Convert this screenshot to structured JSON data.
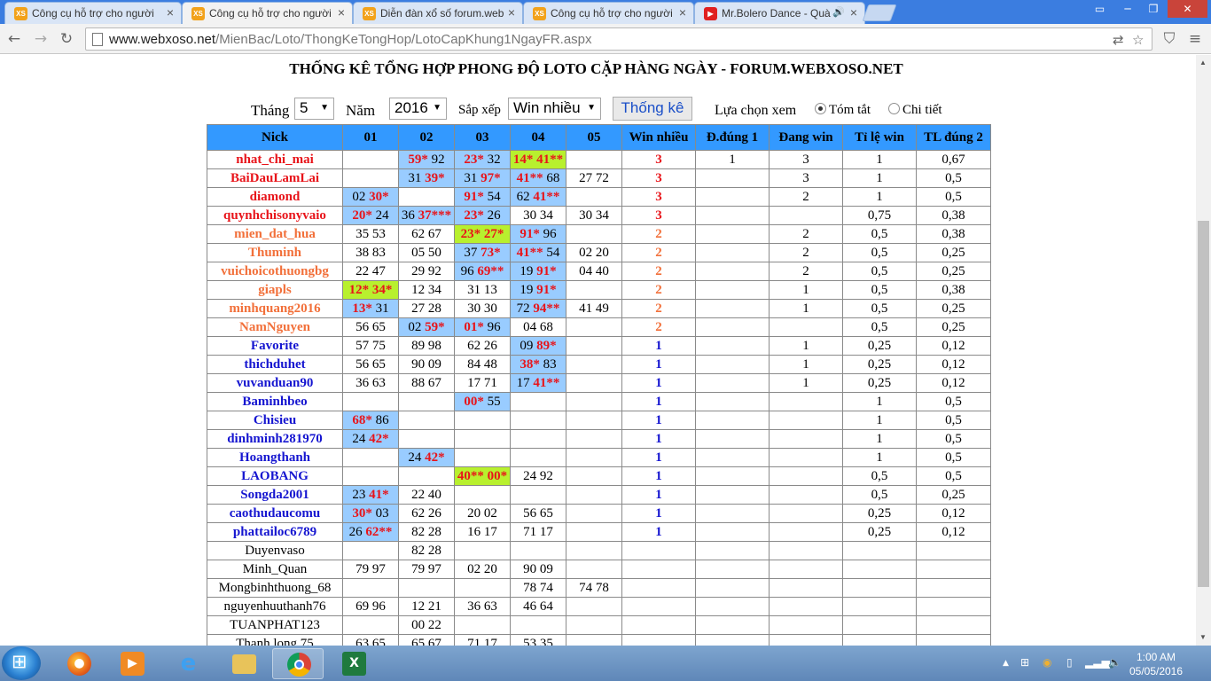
{
  "browser": {
    "tabs": [
      {
        "label": "Công cụ hỗ trợ cho người",
        "favicon": "XS",
        "active": false
      },
      {
        "label": "Công cụ hỗ trợ cho người",
        "favicon": "XS",
        "active": true
      },
      {
        "label": "Diễn đàn xổ số forum.web",
        "favicon": "XS",
        "active": false
      },
      {
        "label": "Công cụ hỗ trợ cho người",
        "favicon": "XS",
        "active": false
      },
      {
        "label": "Mr.Bolero Dance - Quà",
        "favicon": "youtube",
        "active": false,
        "audio": true
      }
    ],
    "url_host": "www.webxoso.net",
    "url_path": "/MienBac/Loto/ThongKeTongHop/LotoCapKhung1NgayFR.aspx"
  },
  "page": {
    "title": "THỐNG KÊ TỔNG HỢP PHONG ĐỘ LOTO CẶP HÀNG NGÀY - FORUM.WEBXOSO.NET",
    "controls": {
      "month_label": "Tháng",
      "month_value": "5",
      "year_label": "Năm",
      "year_value": "2016",
      "sort_label": "Sắp xếp",
      "sort_value": "Win nhiều",
      "submit_label": "Thống kê",
      "view_label": "Lựa chọn xem",
      "view_summary": "Tóm tắt",
      "view_detail": "Chi tiết",
      "selected_view": "summary"
    }
  },
  "table": {
    "headers": [
      "Nick",
      "01",
      "02",
      "03",
      "04",
      "05",
      "Win nhiều",
      "Đ.đúng 1",
      "Đang win",
      "Tỉ lệ win",
      "TL đúng 2"
    ],
    "colors": {
      "red": "#e8141a",
      "orange": "#f2703a",
      "blue": "#1515d0",
      "header_bg": "#3399ff",
      "hit_bg": "#99ccff",
      "double_hit_bg": "#b8f02e"
    },
    "rows": [
      {
        "nick": "nhat_chi_mai",
        "color": "red",
        "days": [
          {
            "t": "",
            "bg": ""
          },
          {
            "t": "59* 92",
            "bg": "blue"
          },
          {
            "t": "23* 32",
            "bg": "blue"
          },
          {
            "t": "14* 41**",
            "bg": "green"
          },
          {
            "t": "",
            "bg": ""
          }
        ],
        "win": "3",
        "dd1": "1",
        "dangwin": "3",
        "tlwin": "1",
        "tl2": "0,67"
      },
      {
        "nick": "BaiDauLamLai",
        "color": "red",
        "days": [
          {
            "t": "",
            "bg": ""
          },
          {
            "t": "31 39*",
            "bg": "blue"
          },
          {
            "t": "31 97*",
            "bg": "blue"
          },
          {
            "t": "41** 68",
            "bg": "blue"
          },
          {
            "t": "27 72",
            "bg": ""
          }
        ],
        "win": "3",
        "dd1": "",
        "dangwin": "3",
        "tlwin": "1",
        "tl2": "0,5"
      },
      {
        "nick": "diamond",
        "color": "red",
        "days": [
          {
            "t": "02 30*",
            "bg": "blue"
          },
          {
            "t": "",
            "bg": ""
          },
          {
            "t": "91* 54",
            "bg": "blue"
          },
          {
            "t": "62 41**",
            "bg": "blue"
          },
          {
            "t": "",
            "bg": ""
          }
        ],
        "win": "3",
        "dd1": "",
        "dangwin": "2",
        "tlwin": "1",
        "tl2": "0,5"
      },
      {
        "nick": "quynhchisonyvaio",
        "color": "red",
        "days": [
          {
            "t": "20* 24",
            "bg": "blue"
          },
          {
            "t": "36 37***",
            "bg": "blue"
          },
          {
            "t": "23* 26",
            "bg": "blue"
          },
          {
            "t": "30 34",
            "bg": ""
          },
          {
            "t": "30 34",
            "bg": ""
          }
        ],
        "win": "3",
        "dd1": "",
        "dangwin": "",
        "tlwin": "0,75",
        "tl2": "0,38"
      },
      {
        "nick": "mien_dat_hua",
        "color": "orange",
        "days": [
          {
            "t": "35 53",
            "bg": ""
          },
          {
            "t": "62 67",
            "bg": ""
          },
          {
            "t": "23* 27*",
            "bg": "green"
          },
          {
            "t": "91* 96",
            "bg": "blue"
          },
          {
            "t": "",
            "bg": ""
          }
        ],
        "win": "2",
        "dd1": "",
        "dangwin": "2",
        "tlwin": "0,5",
        "tl2": "0,38"
      },
      {
        "nick": "Thuminh",
        "color": "orange",
        "days": [
          {
            "t": "38 83",
            "bg": ""
          },
          {
            "t": "05 50",
            "bg": ""
          },
          {
            "t": "37 73*",
            "bg": "blue"
          },
          {
            "t": "41** 54",
            "bg": "blue"
          },
          {
            "t": "02 20",
            "bg": ""
          }
        ],
        "win": "2",
        "dd1": "",
        "dangwin": "2",
        "tlwin": "0,5",
        "tl2": "0,25"
      },
      {
        "nick": "vuichoicothuongbg",
        "color": "orange",
        "days": [
          {
            "t": "22 47",
            "bg": ""
          },
          {
            "t": "29 92",
            "bg": ""
          },
          {
            "t": "96 69**",
            "bg": "blue"
          },
          {
            "t": "19 91*",
            "bg": "blue"
          },
          {
            "t": "04 40",
            "bg": ""
          }
        ],
        "win": "2",
        "dd1": "",
        "dangwin": "2",
        "tlwin": "0,5",
        "tl2": "0,25"
      },
      {
        "nick": "giapls",
        "color": "orange",
        "days": [
          {
            "t": "12* 34*",
            "bg": "green"
          },
          {
            "t": "12 34",
            "bg": ""
          },
          {
            "t": "31 13",
            "bg": ""
          },
          {
            "t": "19 91*",
            "bg": "blue"
          },
          {
            "t": "",
            "bg": ""
          }
        ],
        "win": "2",
        "dd1": "",
        "dangwin": "1",
        "tlwin": "0,5",
        "tl2": "0,38"
      },
      {
        "nick": "minhquang2016",
        "color": "orange",
        "days": [
          {
            "t": "13* 31",
            "bg": "blue"
          },
          {
            "t": "27 28",
            "bg": ""
          },
          {
            "t": "30 30",
            "bg": ""
          },
          {
            "t": "72 94**",
            "bg": "blue"
          },
          {
            "t": "41 49",
            "bg": ""
          }
        ],
        "win": "2",
        "dd1": "",
        "dangwin": "1",
        "tlwin": "0,5",
        "tl2": "0,25"
      },
      {
        "nick": "NamNguyen",
        "color": "orange",
        "days": [
          {
            "t": "56 65",
            "bg": ""
          },
          {
            "t": "02 59*",
            "bg": "blue"
          },
          {
            "t": "01* 96",
            "bg": "blue"
          },
          {
            "t": "04 68",
            "bg": ""
          },
          {
            "t": "",
            "bg": ""
          }
        ],
        "win": "2",
        "dd1": "",
        "dangwin": "",
        "tlwin": "0,5",
        "tl2": "0,25"
      },
      {
        "nick": "Favorite",
        "color": "blue",
        "days": [
          {
            "t": "57 75",
            "bg": ""
          },
          {
            "t": "89 98",
            "bg": ""
          },
          {
            "t": "62 26",
            "bg": ""
          },
          {
            "t": "09 89*",
            "bg": "blue"
          },
          {
            "t": "",
            "bg": ""
          }
        ],
        "win": "1",
        "dd1": "",
        "dangwin": "1",
        "tlwin": "0,25",
        "tl2": "0,12"
      },
      {
        "nick": "thichduhet",
        "color": "blue",
        "days": [
          {
            "t": "56 65",
            "bg": ""
          },
          {
            "t": "90 09",
            "bg": ""
          },
          {
            "t": "84 48",
            "bg": ""
          },
          {
            "t": "38* 83",
            "bg": "blue"
          },
          {
            "t": "",
            "bg": ""
          }
        ],
        "win": "1",
        "dd1": "",
        "dangwin": "1",
        "tlwin": "0,25",
        "tl2": "0,12"
      },
      {
        "nick": "vuvanduan90",
        "color": "blue",
        "days": [
          {
            "t": "36 63",
            "bg": ""
          },
          {
            "t": "88 67",
            "bg": ""
          },
          {
            "t": "17 71",
            "bg": ""
          },
          {
            "t": "17 41**",
            "bg": "blue"
          },
          {
            "t": "",
            "bg": ""
          }
        ],
        "win": "1",
        "dd1": "",
        "dangwin": "1",
        "tlwin": "0,25",
        "tl2": "0,12"
      },
      {
        "nick": "Baminhbeo",
        "color": "blue",
        "days": [
          {
            "t": "",
            "bg": ""
          },
          {
            "t": "",
            "bg": ""
          },
          {
            "t": "00* 55",
            "bg": "blue"
          },
          {
            "t": "",
            "bg": ""
          },
          {
            "t": "",
            "bg": ""
          }
        ],
        "win": "1",
        "dd1": "",
        "dangwin": "",
        "tlwin": "1",
        "tl2": "0,5"
      },
      {
        "nick": "Chisieu",
        "color": "blue",
        "days": [
          {
            "t": "68* 86",
            "bg": "blue"
          },
          {
            "t": "",
            "bg": ""
          },
          {
            "t": "",
            "bg": ""
          },
          {
            "t": "",
            "bg": ""
          },
          {
            "t": "",
            "bg": ""
          }
        ],
        "win": "1",
        "dd1": "",
        "dangwin": "",
        "tlwin": "1",
        "tl2": "0,5"
      },
      {
        "nick": "dinhminh281970",
        "color": "blue",
        "days": [
          {
            "t": "24 42*",
            "bg": "blue"
          },
          {
            "t": "",
            "bg": ""
          },
          {
            "t": "",
            "bg": ""
          },
          {
            "t": "",
            "bg": ""
          },
          {
            "t": "",
            "bg": ""
          }
        ],
        "win": "1",
        "dd1": "",
        "dangwin": "",
        "tlwin": "1",
        "tl2": "0,5"
      },
      {
        "nick": "Hoangthanh",
        "color": "blue",
        "days": [
          {
            "t": "",
            "bg": ""
          },
          {
            "t": "24 42*",
            "bg": "blue"
          },
          {
            "t": "",
            "bg": ""
          },
          {
            "t": "",
            "bg": ""
          },
          {
            "t": "",
            "bg": ""
          }
        ],
        "win": "1",
        "dd1": "",
        "dangwin": "",
        "tlwin": "1",
        "tl2": "0,5"
      },
      {
        "nick": "LAOBANG",
        "color": "blue",
        "days": [
          {
            "t": "",
            "bg": ""
          },
          {
            "t": "",
            "bg": ""
          },
          {
            "t": "40** 00*",
            "bg": "green"
          },
          {
            "t": "24 92",
            "bg": ""
          },
          {
            "t": "",
            "bg": ""
          }
        ],
        "win": "1",
        "dd1": "",
        "dangwin": "",
        "tlwin": "0,5",
        "tl2": "0,5"
      },
      {
        "nick": "Songda2001",
        "color": "blue",
        "days": [
          {
            "t": "23 41*",
            "bg": "blue"
          },
          {
            "t": "22 40",
            "bg": ""
          },
          {
            "t": "",
            "bg": ""
          },
          {
            "t": "",
            "bg": ""
          },
          {
            "t": "",
            "bg": ""
          }
        ],
        "win": "1",
        "dd1": "",
        "dangwin": "",
        "tlwin": "0,5",
        "tl2": "0,25"
      },
      {
        "nick": "caothudaucomu",
        "color": "blue",
        "days": [
          {
            "t": "30* 03",
            "bg": "blue"
          },
          {
            "t": "62 26",
            "bg": ""
          },
          {
            "t": "20 02",
            "bg": ""
          },
          {
            "t": "56 65",
            "bg": ""
          },
          {
            "t": "",
            "bg": ""
          }
        ],
        "win": "1",
        "dd1": "",
        "dangwin": "",
        "tlwin": "0,25",
        "tl2": "0,12"
      },
      {
        "nick": "phattailoc6789",
        "color": "blue",
        "days": [
          {
            "t": "26 62**",
            "bg": "blue"
          },
          {
            "t": "82 28",
            "bg": ""
          },
          {
            "t": "16 17",
            "bg": ""
          },
          {
            "t": "71 17",
            "bg": ""
          },
          {
            "t": "",
            "bg": ""
          }
        ],
        "win": "1",
        "dd1": "",
        "dangwin": "",
        "tlwin": "0,25",
        "tl2": "0,12"
      },
      {
        "nick": "Duyenvaso",
        "color": "black",
        "days": [
          {
            "t": "",
            "bg": ""
          },
          {
            "t": "82 28",
            "bg": ""
          },
          {
            "t": "",
            "bg": ""
          },
          {
            "t": "",
            "bg": ""
          },
          {
            "t": "",
            "bg": ""
          }
        ],
        "win": "",
        "dd1": "",
        "dangwin": "",
        "tlwin": "",
        "tl2": ""
      },
      {
        "nick": "Minh_Quan",
        "color": "black",
        "days": [
          {
            "t": "79 97",
            "bg": ""
          },
          {
            "t": "79 97",
            "bg": ""
          },
          {
            "t": "02 20",
            "bg": ""
          },
          {
            "t": "90 09",
            "bg": ""
          },
          {
            "t": "",
            "bg": ""
          }
        ],
        "win": "",
        "dd1": "",
        "dangwin": "",
        "tlwin": "",
        "tl2": ""
      },
      {
        "nick": "Mongbinhthuong_68",
        "color": "black",
        "days": [
          {
            "t": "",
            "bg": ""
          },
          {
            "t": "",
            "bg": ""
          },
          {
            "t": "",
            "bg": ""
          },
          {
            "t": "78 74",
            "bg": ""
          },
          {
            "t": "74 78",
            "bg": ""
          }
        ],
        "win": "",
        "dd1": "",
        "dangwin": "",
        "tlwin": "",
        "tl2": ""
      },
      {
        "nick": "nguyenhuuthanh76",
        "color": "black",
        "days": [
          {
            "t": "69 96",
            "bg": ""
          },
          {
            "t": "12 21",
            "bg": ""
          },
          {
            "t": "36 63",
            "bg": ""
          },
          {
            "t": "46 64",
            "bg": ""
          },
          {
            "t": "",
            "bg": ""
          }
        ],
        "win": "",
        "dd1": "",
        "dangwin": "",
        "tlwin": "",
        "tl2": ""
      },
      {
        "nick": "TUANPHAT123",
        "color": "black",
        "days": [
          {
            "t": "",
            "bg": ""
          },
          {
            "t": "00 22",
            "bg": ""
          },
          {
            "t": "",
            "bg": ""
          },
          {
            "t": "",
            "bg": ""
          },
          {
            "t": "",
            "bg": ""
          }
        ],
        "win": "",
        "dd1": "",
        "dangwin": "",
        "tlwin": "",
        "tl2": ""
      },
      {
        "nick": "Thanh long 75",
        "color": "black",
        "days": [
          {
            "t": "63 65",
            "bg": ""
          },
          {
            "t": "65 67",
            "bg": ""
          },
          {
            "t": "71 17",
            "bg": ""
          },
          {
            "t": "53 35",
            "bg": ""
          },
          {
            "t": "",
            "bg": ""
          }
        ],
        "win": "",
        "dd1": "",
        "dangwin": "",
        "tlwin": "",
        "tl2": ""
      }
    ]
  },
  "taskbar": {
    "apps": [
      "start-orb",
      "firefox",
      "media-player",
      "internet-explorer",
      "file-explorer",
      "chrome",
      "excel"
    ],
    "active_app": "chrome",
    "clock_time": "1:00 AM",
    "clock_date": "05/05/2016"
  }
}
